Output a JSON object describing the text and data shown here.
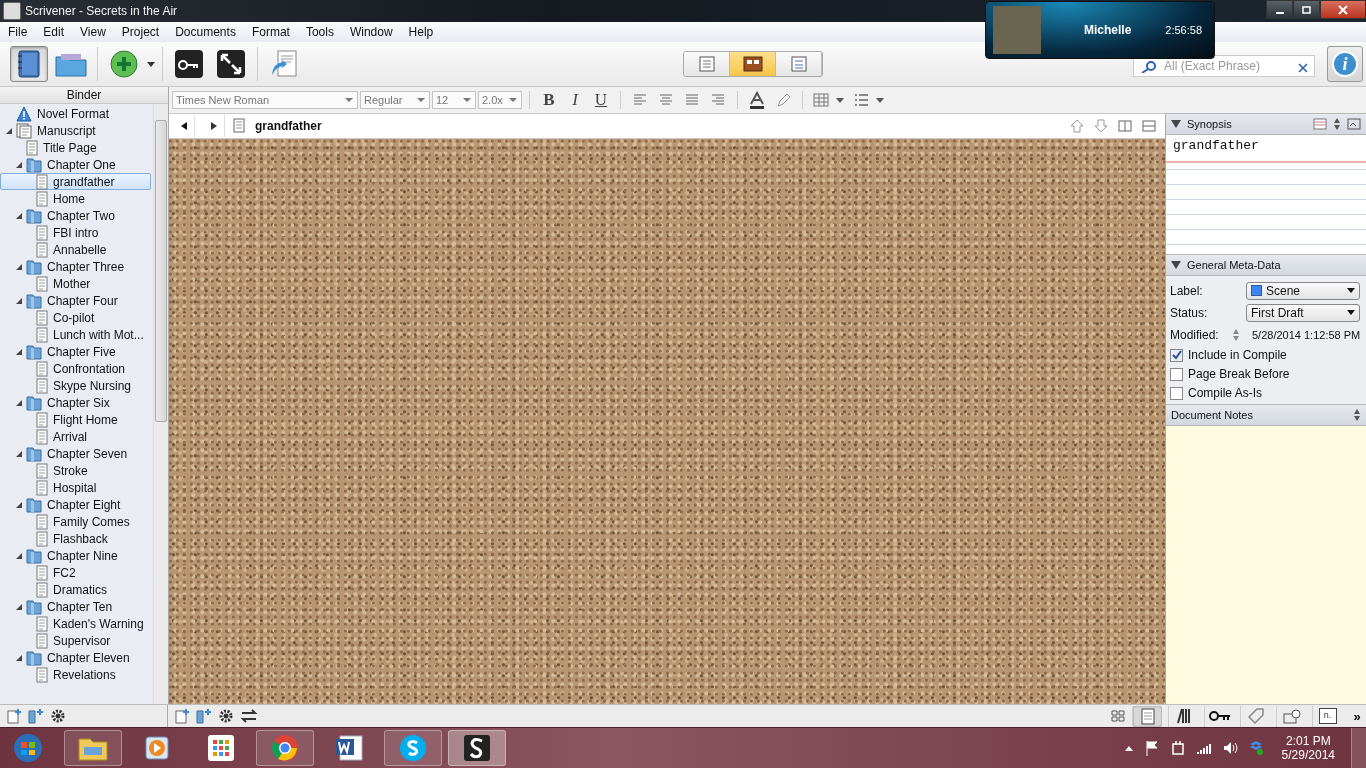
{
  "window": {
    "title": "Scrivener - Secrets in the Air"
  },
  "menu": [
    "File",
    "Edit",
    "View",
    "Project",
    "Documents",
    "Format",
    "Tools",
    "Window",
    "Help"
  ],
  "toolbar": {
    "binder_toggle_selected": true,
    "view_modes": [
      {
        "selected": false
      },
      {
        "selected": true
      },
      {
        "selected": false
      }
    ],
    "search": {
      "placeholder": "All (Exact Phrase)"
    },
    "inspector_glyph": "i"
  },
  "call_overlay": {
    "name": "Michelle",
    "duration": "2:56:58"
  },
  "format_bar": {
    "font": "Times New Roman",
    "style": "Regular",
    "size": "12",
    "spacing": "2.0x",
    "bold": "B",
    "italic": "I",
    "underline": "U"
  },
  "binder": {
    "header": "Binder",
    "items": [
      {
        "label": "Novel Format",
        "kind": "info",
        "selected": false
      },
      {
        "label": "Manuscript",
        "kind": "manuscript",
        "selected": false,
        "expanded": true,
        "children": [
          {
            "label": "Title Page",
            "kind": "document",
            "selected": false
          },
          {
            "label": "Chapter One",
            "kind": "folder",
            "selected": false,
            "expanded": true,
            "children": [
              {
                "label": "grandfather",
                "kind": "document",
                "selected": true
              },
              {
                "label": "Home",
                "kind": "document",
                "selected": false
              }
            ]
          },
          {
            "label": "Chapter Two",
            "kind": "folder",
            "selected": false,
            "expanded": true,
            "children": [
              {
                "label": "FBI intro",
                "kind": "document",
                "selected": false
              },
              {
                "label": "Annabelle",
                "kind": "document",
                "selected": false
              }
            ]
          },
          {
            "label": "Chapter Three",
            "kind": "folder",
            "selected": false,
            "expanded": true,
            "children": [
              {
                "label": "Mother",
                "kind": "document",
                "selected": false
              }
            ]
          },
          {
            "label": "Chapter Four",
            "kind": "folder",
            "selected": false,
            "expanded": true,
            "children": [
              {
                "label": "Co-pilot",
                "kind": "document",
                "selected": false
              },
              {
                "label": "Lunch with Mot...",
                "kind": "document",
                "selected": false
              }
            ]
          },
          {
            "label": "Chapter Five",
            "kind": "folder",
            "selected": false,
            "expanded": true,
            "children": [
              {
                "label": "Confrontation",
                "kind": "document",
                "selected": false
              },
              {
                "label": "Skype Nursing",
                "kind": "document",
                "selected": false
              }
            ]
          },
          {
            "label": "Chapter Six",
            "kind": "folder",
            "selected": false,
            "expanded": true,
            "children": [
              {
                "label": "Flight Home",
                "kind": "document",
                "selected": false
              },
              {
                "label": "Arrival",
                "kind": "document",
                "selected": false
              }
            ]
          },
          {
            "label": "Chapter Seven",
            "kind": "folder",
            "selected": false,
            "expanded": true,
            "children": [
              {
                "label": "Stroke",
                "kind": "document",
                "selected": false
              },
              {
                "label": "Hospital",
                "kind": "document",
                "selected": false
              }
            ]
          },
          {
            "label": "Chapter Eight",
            "kind": "folder",
            "selected": false,
            "expanded": true,
            "children": [
              {
                "label": "Family Comes",
                "kind": "document",
                "selected": false
              },
              {
                "label": "Flashback",
                "kind": "document",
                "selected": false
              }
            ]
          },
          {
            "label": "Chapter Nine",
            "kind": "folder",
            "selected": false,
            "expanded": true,
            "children": [
              {
                "label": "FC2",
                "kind": "document",
                "selected": false
              },
              {
                "label": "Dramatics",
                "kind": "document",
                "selected": false
              }
            ]
          },
          {
            "label": "Chapter Ten",
            "kind": "folder",
            "selected": false,
            "expanded": true,
            "children": [
              {
                "label": "Kaden's Warning",
                "kind": "document",
                "selected": false
              },
              {
                "label": "Supervisor",
                "kind": "document",
                "selected": false
              }
            ]
          },
          {
            "label": "Chapter Eleven",
            "kind": "folder",
            "selected": false,
            "expanded": true,
            "children": [
              {
                "label": "Revelations",
                "kind": "document",
                "selected": false
              }
            ]
          }
        ]
      }
    ]
  },
  "editor": {
    "title": "grandfather"
  },
  "inspector": {
    "synopsis_header": "Synopsis",
    "synopsis": "grandfather",
    "metadata_header": "General Meta-Data",
    "fields": [
      {
        "name": "Label:",
        "kind": "dropdown",
        "value": "Scene",
        "color": "#3d85f0"
      },
      {
        "name": "Status:",
        "kind": "dropdown",
        "value": "First Draft"
      },
      {
        "name": "Modified:",
        "kind": "date",
        "value": "5/28/2014 1:12:58 PM"
      }
    ],
    "checkboxes": [
      {
        "label": "Include in Compile",
        "checked": true
      },
      {
        "label": "Page Break Before",
        "checked": false
      },
      {
        "label": "Compile As-Is",
        "checked": false
      }
    ],
    "notes_header": "Document Notes",
    "tabs": [
      {
        "kind": "notes",
        "selected": true
      },
      {
        "kind": "references",
        "selected": false
      },
      {
        "kind": "keywords",
        "selected": false
      },
      {
        "kind": "metadata",
        "selected": false
      },
      {
        "kind": "snapshots",
        "selected": false
      },
      {
        "kind": "comments",
        "selected": false,
        "glyph": "n."
      }
    ],
    "more": "»"
  },
  "taskbar": {
    "time": "2:01 PM",
    "date": "5/29/2014"
  }
}
